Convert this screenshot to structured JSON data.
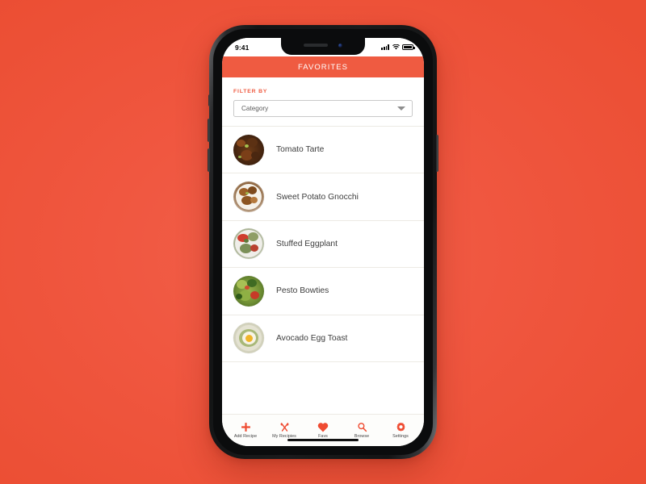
{
  "background": {
    "color": "#F0563E"
  },
  "device": {
    "name": "iPhone X mockup",
    "buttons": [
      "silent-switch",
      "volume-up",
      "volume-down",
      "power"
    ]
  },
  "status_bar": {
    "time": "9:41",
    "icons": [
      "signal-icon",
      "wifi-icon",
      "battery-icon"
    ]
  },
  "header": {
    "title": "FAVORITES",
    "background": "#EF5B41",
    "text_color": "#FFFFFF"
  },
  "filter": {
    "label": "FILTER BY",
    "label_color": "#EF5B41",
    "select": {
      "value": "Category",
      "placeholder": "Category",
      "chevron": "chevron-down-icon"
    }
  },
  "recipes": [
    {
      "name": "Tomato Tarte",
      "thumb_class": "food-tomato-tarte"
    },
    {
      "name": "Sweet Potato Gnocchi",
      "thumb_class": "food-sweet-potato-gnocchi"
    },
    {
      "name": "Stuffed Eggplant",
      "thumb_class": "food-stuffed-eggplant"
    },
    {
      "name": "Pesto Bowties",
      "thumb_class": "food-pesto-bowties"
    },
    {
      "name": "Avocado Egg Toast",
      "thumb_class": "food-avocado-egg-toast"
    }
  ],
  "tab_bar": {
    "accent_color": "#EF4B31",
    "items": [
      {
        "label": "Add Recipe",
        "icon": "plus-icon"
      },
      {
        "label": "My Recipies",
        "icon": "utensils-icon"
      },
      {
        "label": "Favs",
        "icon": "heart-icon"
      },
      {
        "label": "Browse",
        "icon": "search-icon"
      },
      {
        "label": "Settings",
        "icon": "gear-icon"
      }
    ],
    "active": "Favs"
  }
}
